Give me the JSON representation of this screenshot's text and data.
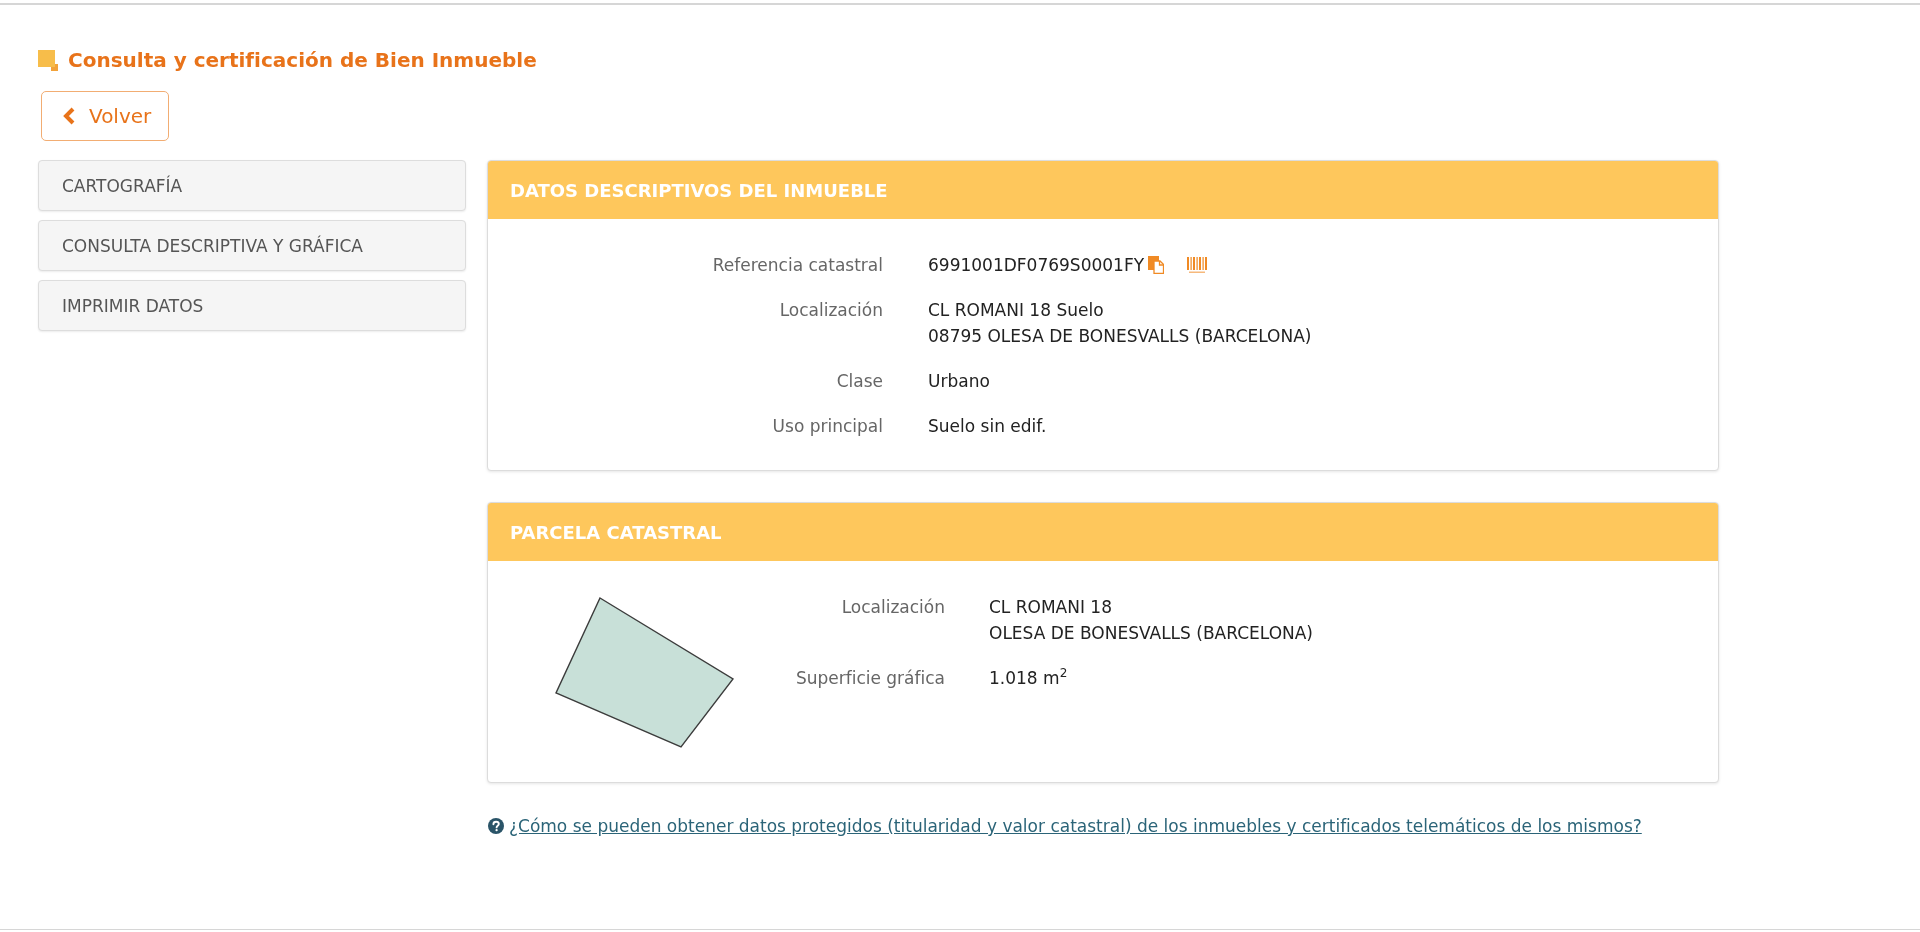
{
  "title": {
    "text": "Consulta y certificación de Bien Inmueble"
  },
  "back_button": {
    "label": "Volver"
  },
  "sidebar": {
    "items": [
      {
        "label": "CARTOGRAFÍA"
      },
      {
        "label": "CONSULTA DESCRIPTIVA Y GRÁFICA"
      },
      {
        "label": "IMPRIMIR DATOS"
      }
    ]
  },
  "panels": [
    {
      "kind": "details",
      "title": "DATOS DESCRIPTIVOS DEL INMUEBLE",
      "fields": [
        {
          "kind": "reference",
          "label": "Referencia catastral",
          "lines": [
            "6991001DF0769S0001FY"
          ]
        },
        {
          "kind": "text",
          "label": "Localización",
          "lines": [
            "CL ROMANI 18 Suelo",
            "08795 OLESA DE BONESVALLS (BARCELONA)"
          ]
        },
        {
          "kind": "text",
          "label": "Clase",
          "lines": [
            "Urbano"
          ]
        },
        {
          "kind": "text",
          "label": "Uso principal",
          "lines": [
            "Suelo sin edif."
          ]
        }
      ]
    },
    {
      "kind": "parcel",
      "title": "PARCELA CATASTRAL",
      "fields": [
        {
          "kind": "text",
          "label": "Localización",
          "lines": [
            "CL ROMANI 18",
            "OLESA DE BONESVALLS (BARCELONA)"
          ]
        },
        {
          "kind": "text",
          "label": "Superficie gráfica",
          "lines": [
            "1.018 m$^{2}$"
          ]
        }
      ]
    }
  ],
  "help_link": {
    "text": "¿Cómo se pueden obtener datos protegidos (titularidad y valor catastral) de los inmuebles y certificados telemáticos de los mismos?"
  }
}
